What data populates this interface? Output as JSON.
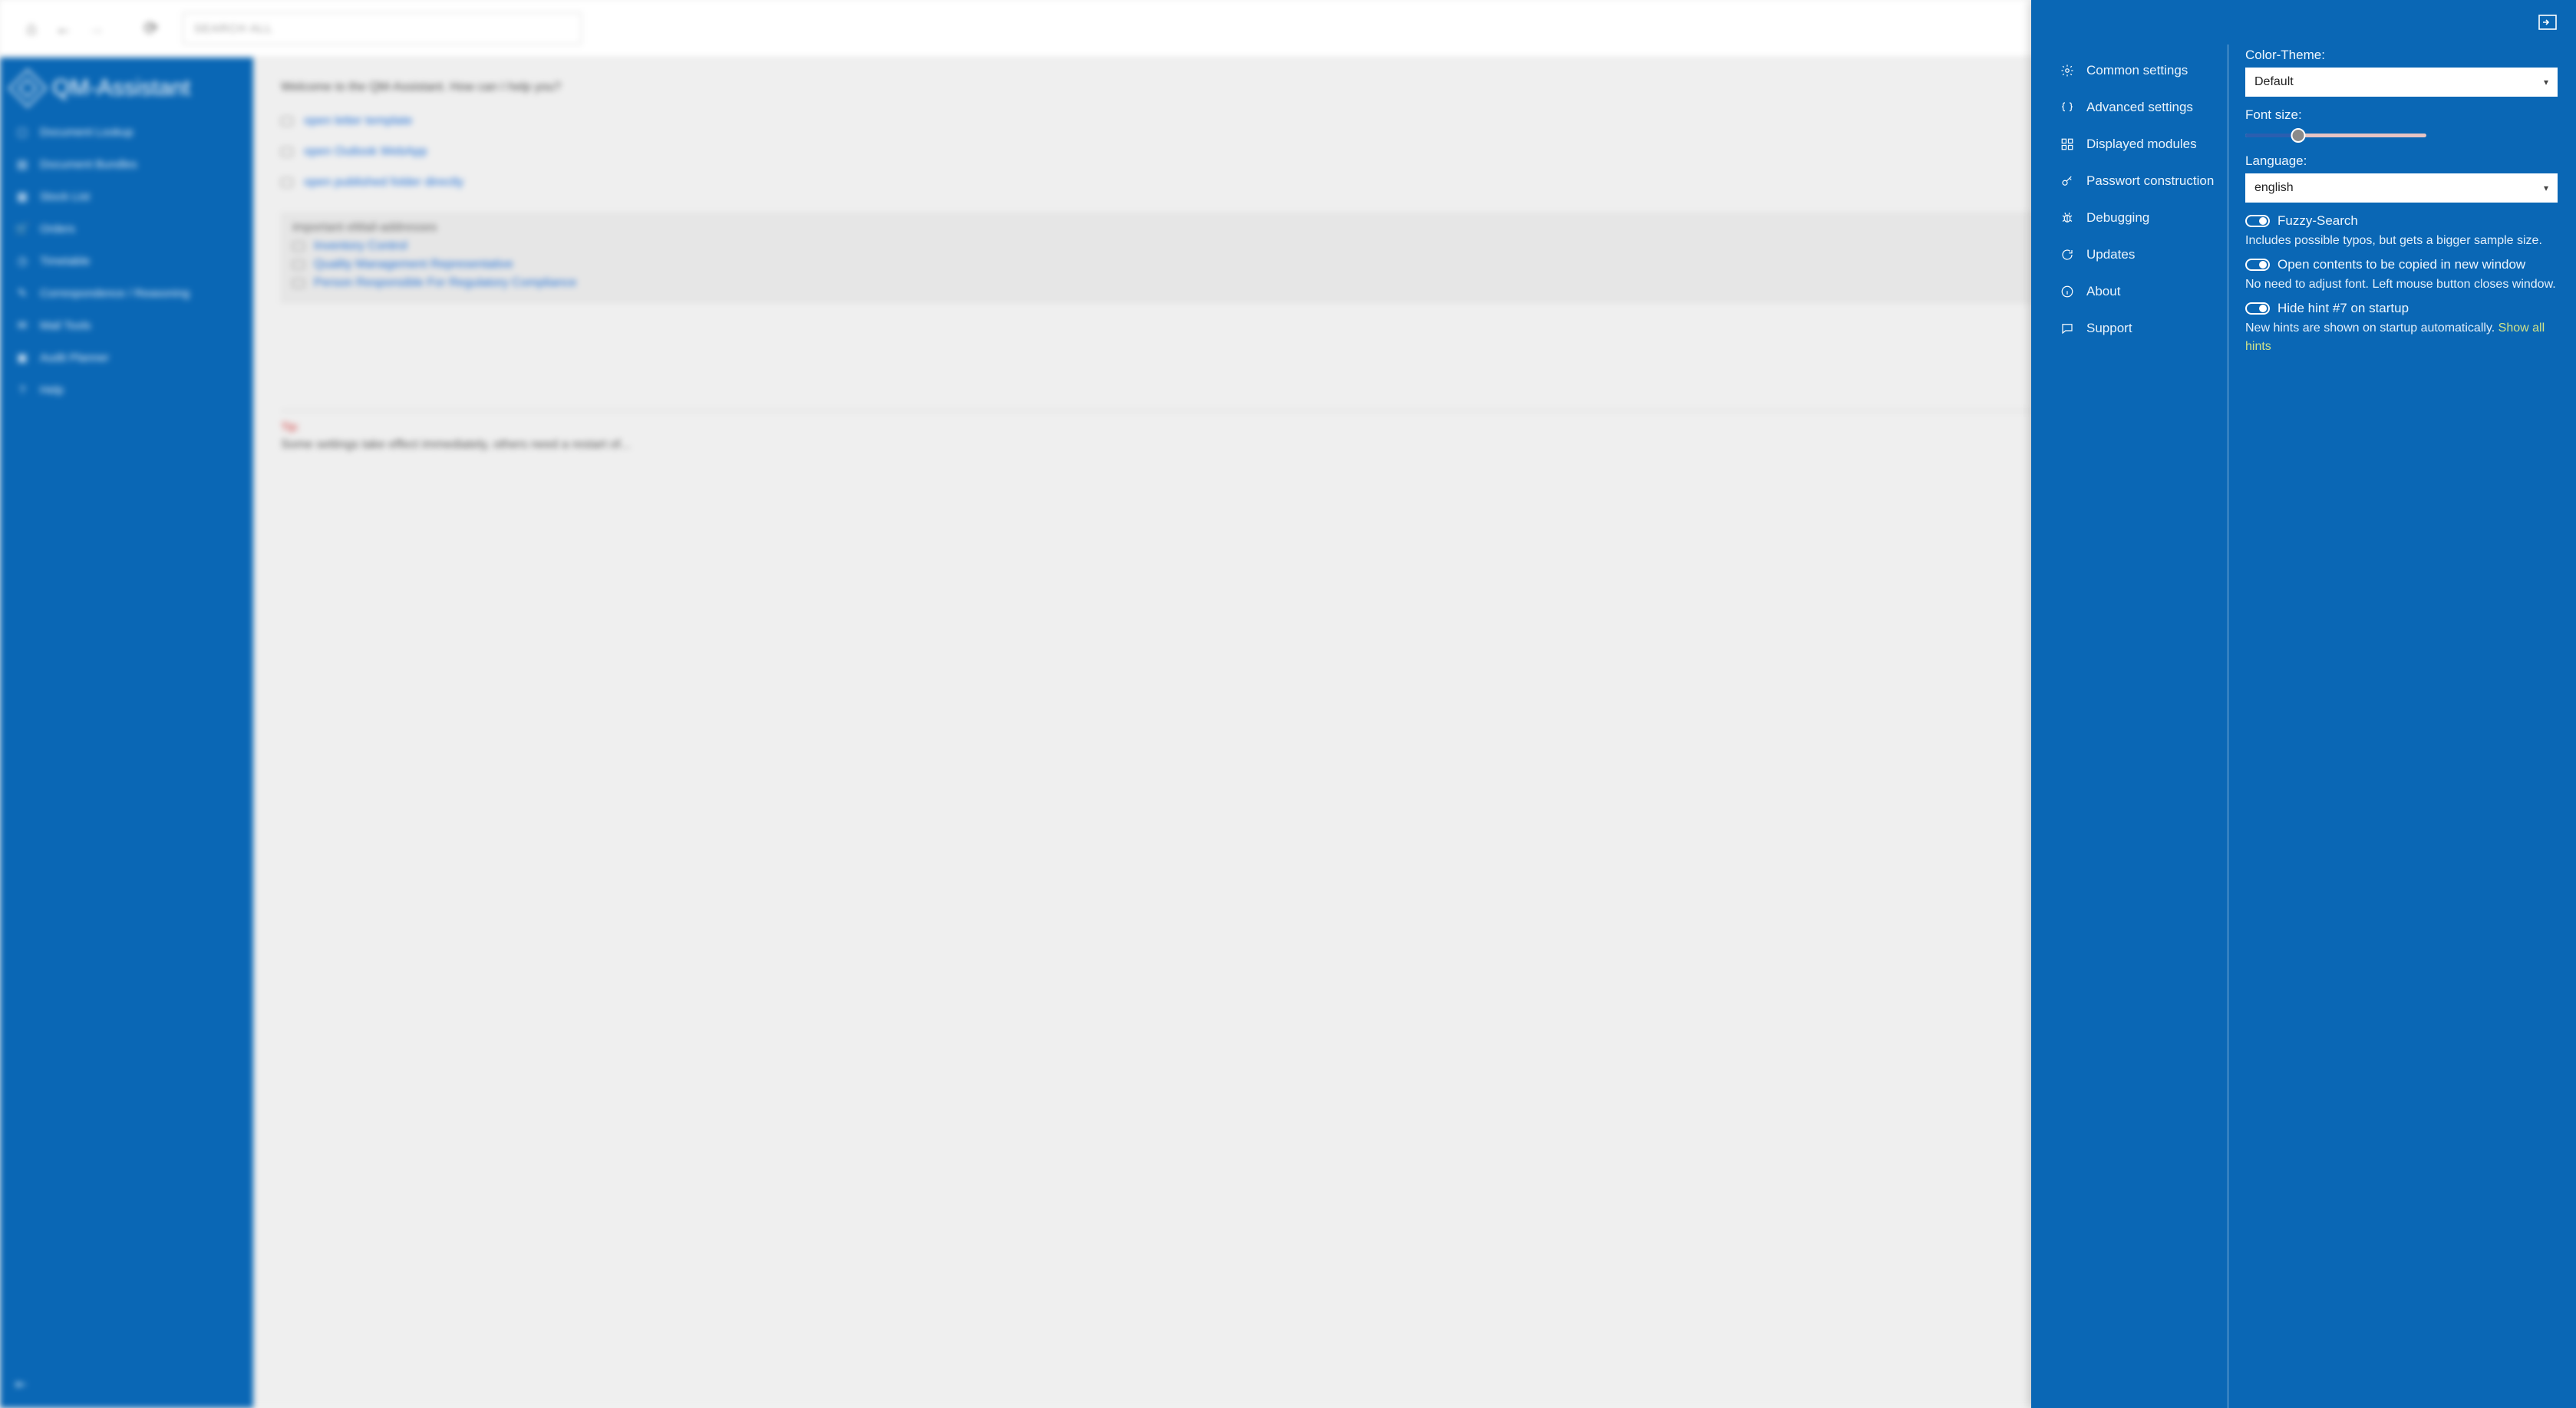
{
  "topbar": {
    "search_placeholder": "SEARCH ALL"
  },
  "sidebar": {
    "title": "QM-Assistant",
    "items": [
      {
        "label": "Document Lookup"
      },
      {
        "label": "Document Bundles"
      },
      {
        "label": "Stock List"
      },
      {
        "label": "Orders"
      },
      {
        "label": "Timetable"
      },
      {
        "label": "Correspondence / Reasoning"
      },
      {
        "label": "Mail Tools"
      },
      {
        "label": "Audit Planner"
      },
      {
        "label": "Help"
      }
    ]
  },
  "main": {
    "welcome": "Welcome to the QM-Assistant. How can I help you?",
    "quicklinks": [
      {
        "label": "open letter template"
      },
      {
        "label": "open Outlook WebApp"
      },
      {
        "label": "open published folder directly"
      }
    ],
    "email_section": {
      "heading": "important eMail-addresses",
      "items": [
        {
          "label": "Inventory Control"
        },
        {
          "label": "Quality Management Representative"
        },
        {
          "label": "Person Responsible For Regulatory Compliance"
        }
      ]
    },
    "tip": {
      "label": "Tip:",
      "text": "Some settings take effect immediately, others need a restart of..."
    }
  },
  "settings": {
    "menu": [
      {
        "key": "common",
        "label": "Common settings"
      },
      {
        "key": "advanced",
        "label": "Advanced settings"
      },
      {
        "key": "modules",
        "label": "Displayed modules"
      },
      {
        "key": "password",
        "label": "Passwort construction"
      },
      {
        "key": "debug",
        "label": "Debugging"
      },
      {
        "key": "updates",
        "label": "Updates"
      },
      {
        "key": "about",
        "label": "About"
      },
      {
        "key": "support",
        "label": "Support"
      }
    ],
    "common": {
      "color_theme_label": "Color-Theme:",
      "color_theme_value": "Default",
      "font_size_label": "Font size:",
      "language_label": "Language:",
      "language_value": "english",
      "fuzzy": {
        "label": "Fuzzy-Search",
        "desc": "Includes possible typos, but gets a bigger sample size."
      },
      "open_new_window": {
        "label": "Open contents to be copied in new window",
        "desc": "No need to adjust font. Left mouse button closes window."
      },
      "hide_hint": {
        "label": "Hide hint #7 on startup",
        "desc": "New hints are shown on startup automatically. ",
        "link": "Show all hints"
      }
    }
  }
}
